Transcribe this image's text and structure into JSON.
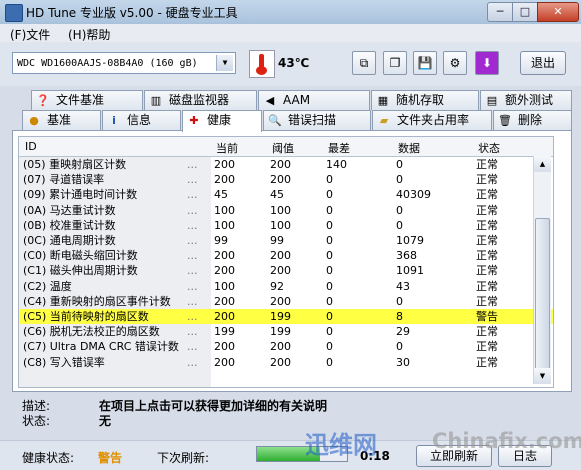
{
  "window": {
    "title": "HD Tune 专业版 v5.00 - 硬盘专业工具",
    "min_label": "─",
    "max_label": "□",
    "close_label": "✕"
  },
  "menu": {
    "file": "(F)文件",
    "help": "(H)帮助"
  },
  "toolbar": {
    "drive": "WDC WD1600AAJS-08B4A0  (160 gB)",
    "temperature": "43℃",
    "exit_label": "退出",
    "icons": [
      "copy-info-icon",
      "copy-all-icon",
      "save-icon",
      "options-icon",
      "download-icon"
    ]
  },
  "tabs_top": [
    {
      "label": "文件基准",
      "icon": "file-benchmark-icon"
    },
    {
      "label": "磁盘监视器",
      "icon": "disk-monitor-icon"
    },
    {
      "label": "AAM",
      "icon": "speaker-icon"
    },
    {
      "label": "随机存取",
      "icon": "random-access-icon"
    },
    {
      "label": "额外测试",
      "icon": "extra-tests-icon"
    }
  ],
  "tabs_bottom": [
    {
      "label": "基准",
      "icon": "benchmark-icon"
    },
    {
      "label": "信息",
      "icon": "info-icon"
    },
    {
      "label": "健康",
      "icon": "health-icon",
      "active": true
    },
    {
      "label": "错误扫描",
      "icon": "magnifier-icon"
    },
    {
      "label": "文件夹占用率",
      "icon": "folder-icon"
    },
    {
      "label": "删除",
      "icon": "trash-icon"
    }
  ],
  "table": {
    "headers": {
      "id": "ID",
      "current": "当前",
      "threshold": "阈值",
      "worst": "最差",
      "data": "数据",
      "status": "状态"
    },
    "rows": [
      {
        "name": "(05) 重映射扇区计数",
        "current": "200",
        "threshold": "200",
        "worst": "140",
        "data": "0",
        "status": "正常"
      },
      {
        "name": "(07) 寻道错误率",
        "current": "200",
        "threshold": "200",
        "worst": "0",
        "data": "0",
        "status": "正常"
      },
      {
        "name": "(09) 累计通电时间计数",
        "current": "45",
        "threshold": "45",
        "worst": "0",
        "data": "40309",
        "status": "正常"
      },
      {
        "name": "(0A) 马达重试计数",
        "current": "100",
        "threshold": "100",
        "worst": "0",
        "data": "0",
        "status": "正常"
      },
      {
        "name": "(0B) 校准重试计数",
        "current": "100",
        "threshold": "100",
        "worst": "0",
        "data": "0",
        "status": "正常"
      },
      {
        "name": "(0C) 通电周期计数",
        "current": "99",
        "threshold": "99",
        "worst": "0",
        "data": "1079",
        "status": "正常"
      },
      {
        "name": "(C0) 断电磁头缩回计数",
        "current": "200",
        "threshold": "200",
        "worst": "0",
        "data": "368",
        "status": "正常"
      },
      {
        "name": "(C1) 磁头伸出周期计数",
        "current": "200",
        "threshold": "200",
        "worst": "0",
        "data": "1091",
        "status": "正常"
      },
      {
        "name": "(C2) 温度",
        "current": "100",
        "threshold": "92",
        "worst": "0",
        "data": "43",
        "status": "正常"
      },
      {
        "name": "(C4) 重新映射的扇区事件计数",
        "current": "200",
        "threshold": "200",
        "worst": "0",
        "data": "0",
        "status": "正常"
      },
      {
        "name": "(C5) 当前待映射的扇区数",
        "current": "200",
        "threshold": "199",
        "worst": "0",
        "data": "8",
        "status": "警告",
        "highlight": true
      },
      {
        "name": "(C6) 脱机无法校正的扇区数",
        "current": "199",
        "threshold": "199",
        "worst": "0",
        "data": "29",
        "status": "正常"
      },
      {
        "name": "(C7) Ultra DMA CRC 错误计数",
        "current": "200",
        "threshold": "200",
        "worst": "0",
        "data": "0",
        "status": "正常"
      },
      {
        "name": "(C8) 写入错误率",
        "current": "200",
        "threshold": "200",
        "worst": "0",
        "data": "30",
        "status": "正常"
      }
    ],
    "dots": "..."
  },
  "details": {
    "desc_label": "描述:",
    "desc_text": "在项目上点击可以获得更加详细的有关说明",
    "state_label": "状态:",
    "state_text": "无"
  },
  "statusbar": {
    "health_label": "健康状态:",
    "health_value": "警告",
    "refresh_label": "下次刷新:",
    "refresh_progress": 0.7,
    "countdown": "0:18",
    "refresh_now": "立即刷新",
    "log": "日志"
  },
  "watermark": {
    "cn": "迅维网",
    "en": "Chinafix.com"
  }
}
